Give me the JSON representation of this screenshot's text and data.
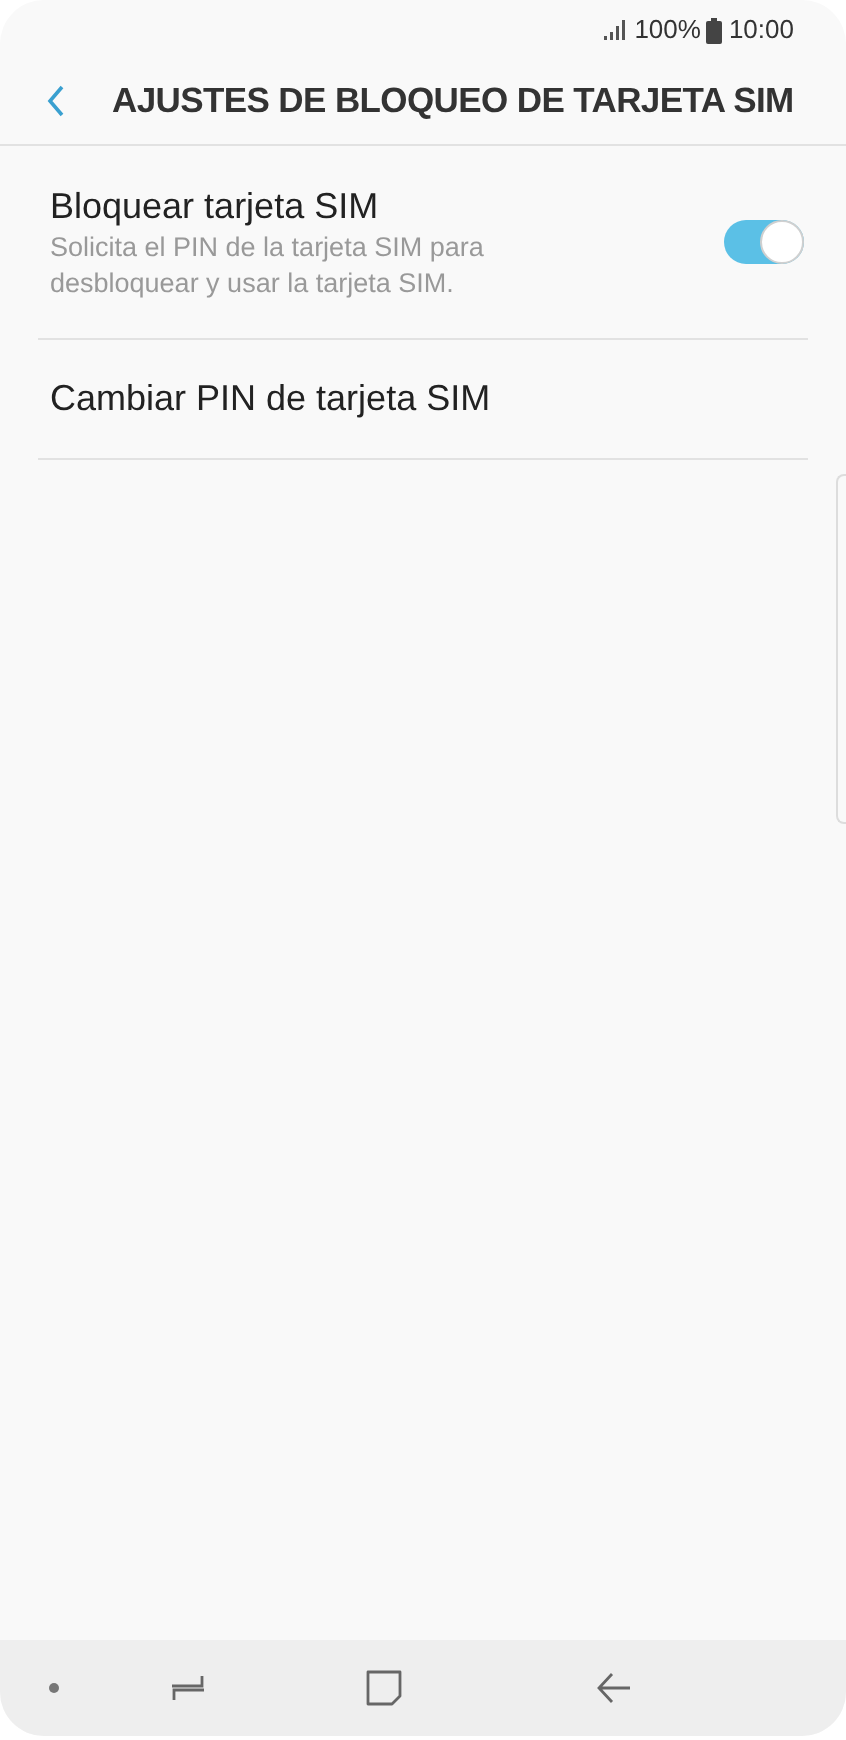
{
  "status_bar": {
    "battery": "100%",
    "time": "10:00"
  },
  "header": {
    "title": "AJUSTES DE BLOQUEO DE TARJETA SIM"
  },
  "settings": [
    {
      "kind": "toggle",
      "title": "Bloquear tarjeta SIM",
      "subtitle": "Solicita el PIN de la tarjeta SIM para desbloquear y usar la tarjeta SIM.",
      "on": true
    },
    {
      "kind": "plain",
      "title": "Cambiar PIN de tarjeta SIM"
    }
  ]
}
